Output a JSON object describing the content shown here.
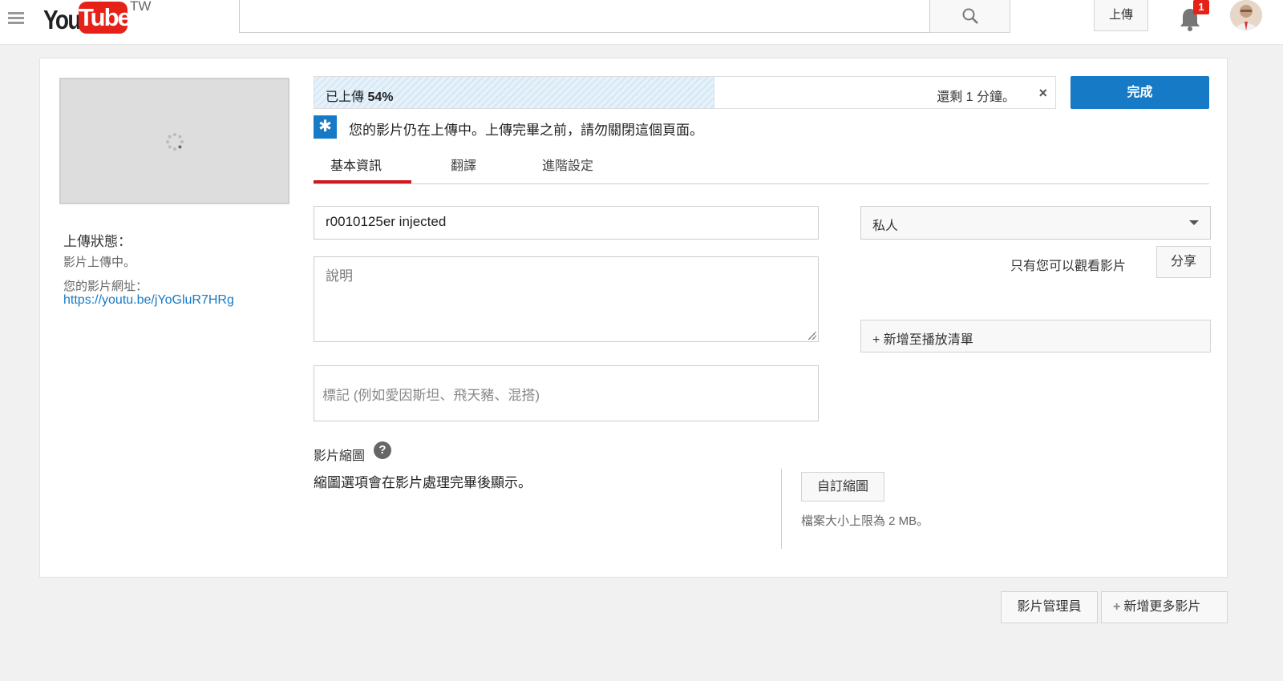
{
  "header": {
    "logo_you": "You",
    "logo_tube": "Tube",
    "logo_region": "TW",
    "search_value": "",
    "upload_label": "上傳",
    "notification_count": "1"
  },
  "sidebar": {
    "status_label": "上傳狀態：",
    "status_text": "影片上傳中。",
    "url_label": "您的影片網址：",
    "url": "https://youtu.be/jYoGluR7HRg"
  },
  "progress": {
    "prefix": "已上傳 ",
    "percent_text": "54%",
    "fraction": 0.54,
    "remaining": "還剩 1 分鐘。",
    "close_glyph": "×"
  },
  "done_label": "完成",
  "notice": {
    "icon_glyph": "✱",
    "text": "您的影片仍在上傳中。上傳完畢之前，請勿關閉這個頁面。"
  },
  "tabs": [
    {
      "label": "基本資訊",
      "active": true
    },
    {
      "label": "翻譯",
      "active": false
    },
    {
      "label": "進階設定",
      "active": false
    }
  ],
  "form": {
    "title_value": "r0010125er injected",
    "description_placeholder": "說明",
    "tags_placeholder": "標記 (例如愛因斯坦、飛天豬、混搭)"
  },
  "privacy": {
    "selected": "私人",
    "note": "只有您可以觀看影片",
    "share_label": "分享"
  },
  "playlist_label": "+ 新增至播放清單",
  "thumbnails": {
    "heading": "影片縮圖",
    "help_glyph": "?",
    "note": "縮圖選項會在影片處理完畢後顯示。",
    "custom_button": "自訂縮圖",
    "file_limit": "檔案大小上限為 2 MB。"
  },
  "footer": {
    "video_manager": "影片管理員",
    "add_more": "新增更多影片",
    "add_more_plus": "+"
  },
  "colors": {
    "accent_blue": "#167ac6",
    "brand_red": "#e62117",
    "tab_underline": "#cc181e"
  },
  "icons": [
    "menu-icon",
    "search-icon",
    "bell-icon",
    "avatar",
    "loading-spinner-icon",
    "star-notice-icon",
    "help-icon",
    "close-icon",
    "chevron-down-icon"
  ]
}
